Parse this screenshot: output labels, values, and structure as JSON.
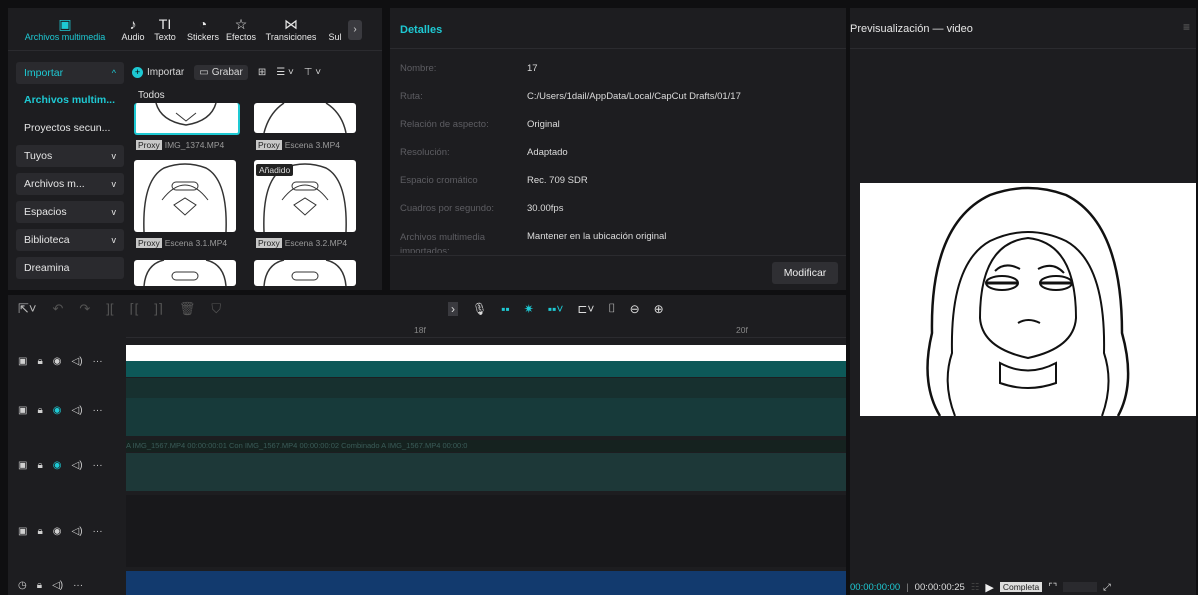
{
  "media_panel": {
    "tabs": [
      {
        "label": "Archivos multimedia",
        "icon": "media-icon"
      },
      {
        "label": "Audio",
        "icon": "audio-icon"
      },
      {
        "label": "Texto",
        "icon": "text-icon"
      },
      {
        "label": "Stickers",
        "icon": "sticker-icon"
      },
      {
        "label": "Efectos",
        "icon": "effects-icon"
      },
      {
        "label": "Transiciones",
        "icon": "transitions-icon"
      },
      {
        "label": "Sul",
        "icon": "subtitles-icon"
      }
    ],
    "sidebar": [
      {
        "label": "Importar",
        "chev": "^"
      },
      {
        "label": "Archivos multim..."
      },
      {
        "label": "Proyectos secun..."
      },
      {
        "label": "Tuyos",
        "chev": "v"
      },
      {
        "label": "Archivos m...",
        "chev": "v"
      },
      {
        "label": "Espacios",
        "chev": "v"
      },
      {
        "label": "Biblioteca",
        "chev": "v"
      },
      {
        "label": "Dreamina"
      }
    ],
    "toolbar": {
      "import": "Importar",
      "record": "Grabar"
    },
    "section": "Todos",
    "clips": [
      {
        "tag": "Proxy",
        "name": "IMG_1374.MP4"
      },
      {
        "tag": "Proxy",
        "name": "Escena 3.MP4"
      },
      {
        "tag": "Proxy",
        "name": "Escena 3.1.MP4"
      },
      {
        "tag": "Proxy",
        "name": "Escena 3.2.MP4"
      }
    ],
    "added_badge": "Añadido"
  },
  "details": {
    "title": "Detalles",
    "rows": [
      {
        "label": "Nombre:",
        "value": "17"
      },
      {
        "label": "Ruta:",
        "value": "C:/Users/1dail/AppData/Local/CapCut Drafts/01/17"
      },
      {
        "label": "Relación de aspecto:",
        "value": "Original"
      },
      {
        "label": "Resolución:",
        "value": "Adaptado"
      },
      {
        "label": "Espacio cromático",
        "value": "Rec. 709 SDR"
      },
      {
        "label": "Cuadros por segundo:",
        "value": "30.00fps"
      },
      {
        "label": "Archivos multimedia importados:",
        "value": "Mantener en la ubicación original"
      }
    ],
    "modify_button": "Modificar"
  },
  "preview": {
    "title": "Previsualización — video",
    "time_current": "00:00:00:00",
    "time_total": "00:00:00:25",
    "quality": "Completa"
  },
  "timeline": {
    "ruler": [
      "18f",
      "20f"
    ],
    "track3_labels": "A                                    IMG_1567.MP4   00:00:00:01   Con  IMG_1567.MP4  00:00:00:02   Combinado A                                          IMG_1567.MP4   00:00:0"
  },
  "colors": {
    "accent": "#1ec9d3",
    "teal_track": "#0d5858",
    "audio_track": "#123a6e"
  }
}
